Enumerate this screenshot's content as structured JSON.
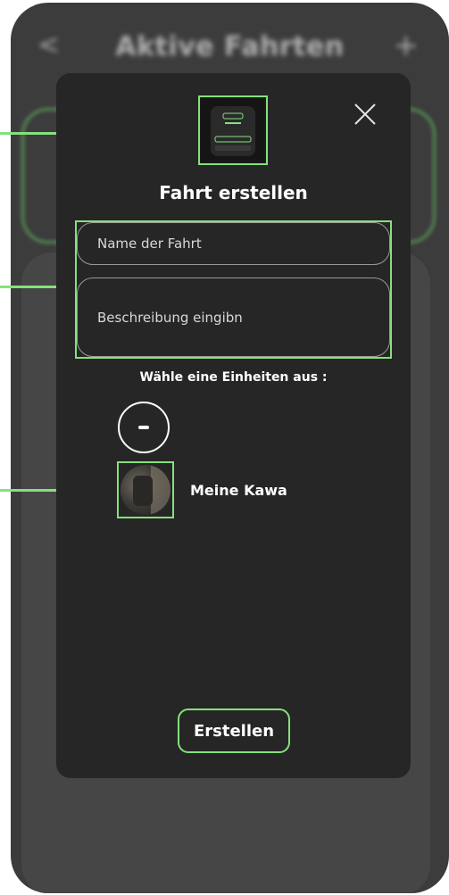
{
  "background": {
    "title": "Aktive Fahrten",
    "back_glyph": "<",
    "add_glyph": "+"
  },
  "modal": {
    "title": "Fahrt erstellen",
    "close_icon": "close-icon",
    "name_placeholder": "Name der Fahrt",
    "description_placeholder": "Beschreibung eingibn",
    "units_label": "Wähle eine Einheiten aus :",
    "unit": {
      "name": "Meine Kawa"
    },
    "submit_label": "Erstellen"
  },
  "colors": {
    "accent": "#86e07d",
    "modal_bg": "#262626",
    "screen_bg": "#3c3c3c"
  }
}
